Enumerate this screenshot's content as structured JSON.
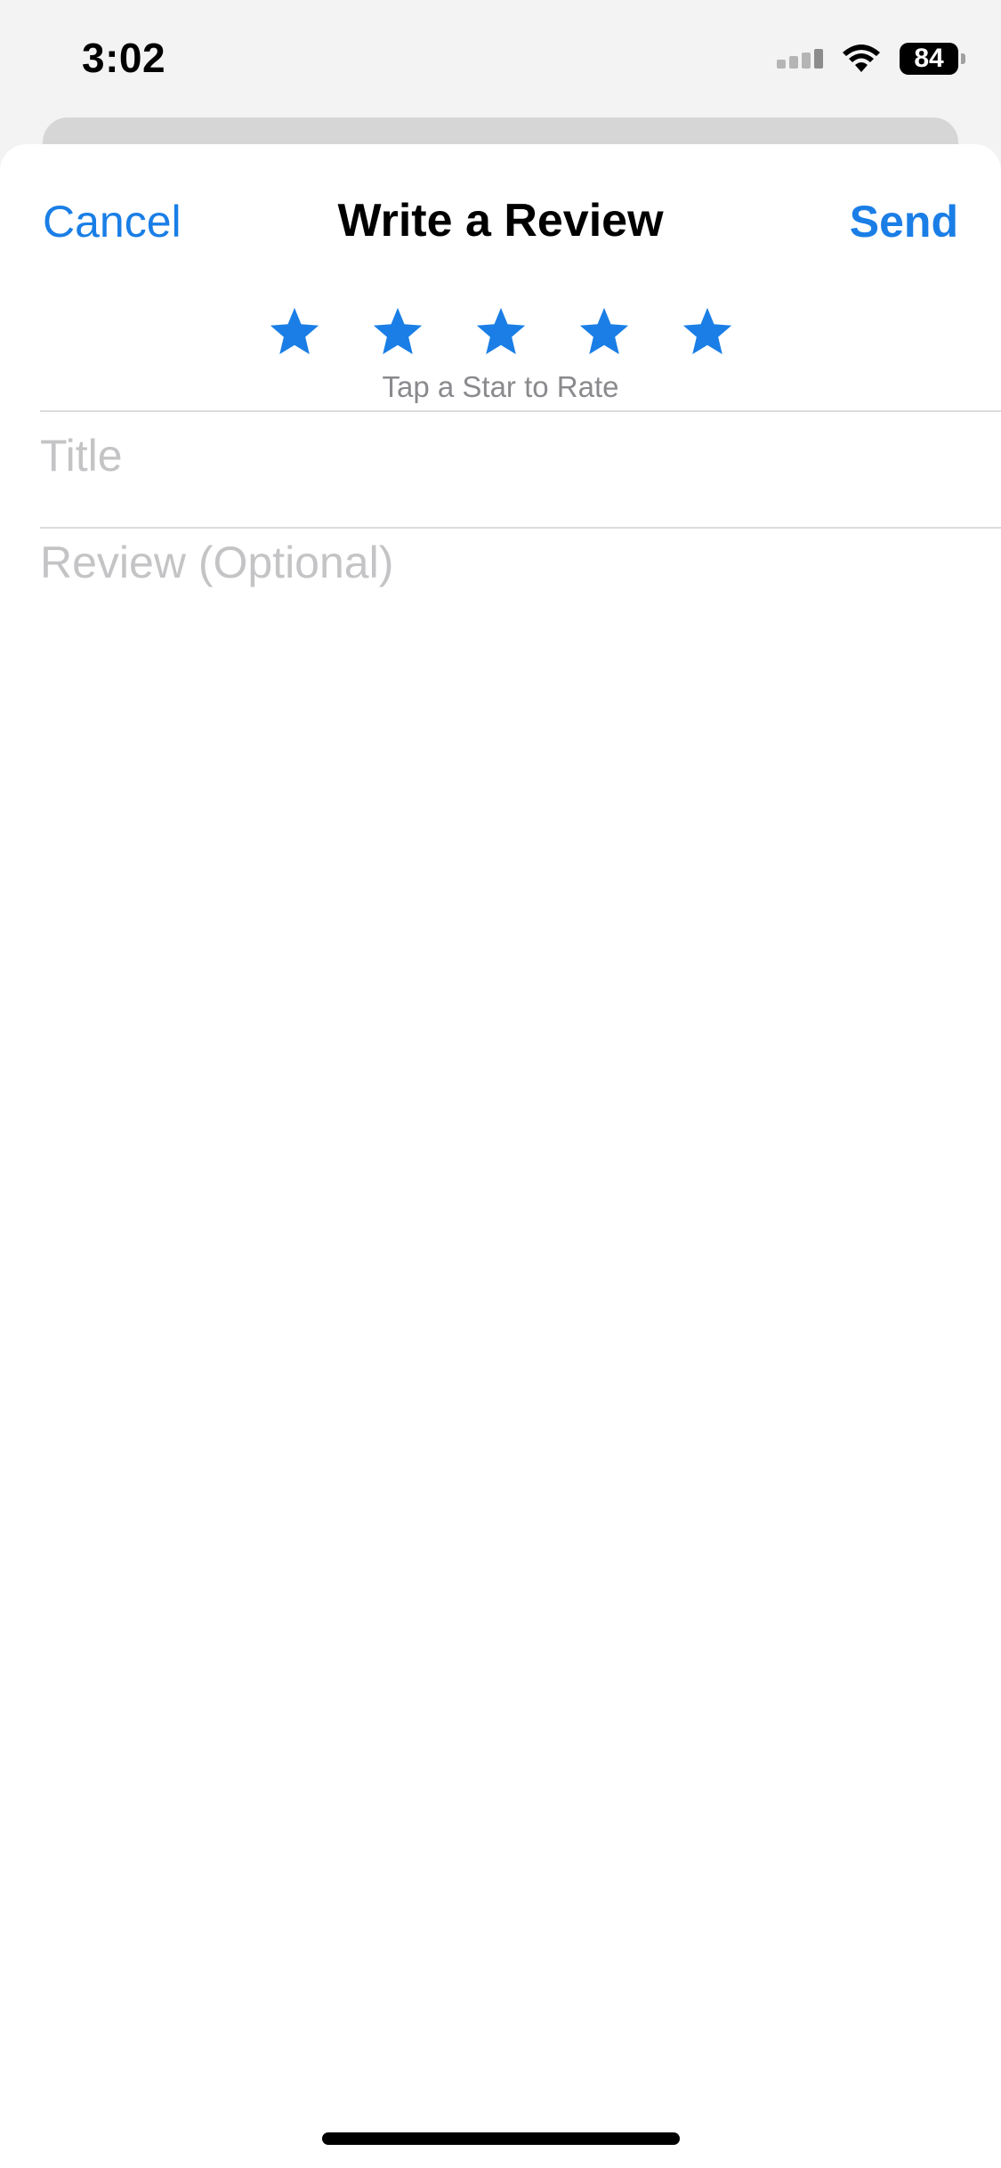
{
  "status_bar": {
    "time": "3:02",
    "battery_level": "84",
    "icons": [
      "signal-icon",
      "wifi-icon",
      "battery-icon"
    ]
  },
  "nav": {
    "cancel_label": "Cancel",
    "title": "Write a Review",
    "send_label": "Send"
  },
  "rating": {
    "star_count": 5,
    "selected": 0,
    "hint": "Tap a Star to Rate"
  },
  "form": {
    "title_placeholder": "Title",
    "review_placeholder": "Review (Optional)"
  },
  "colors": {
    "accent": "#1a7ee6",
    "star": "#1a7ee6",
    "placeholder": "#c4c4c6",
    "hint": "#8a8a8e",
    "divider": "#dcdcdc"
  }
}
